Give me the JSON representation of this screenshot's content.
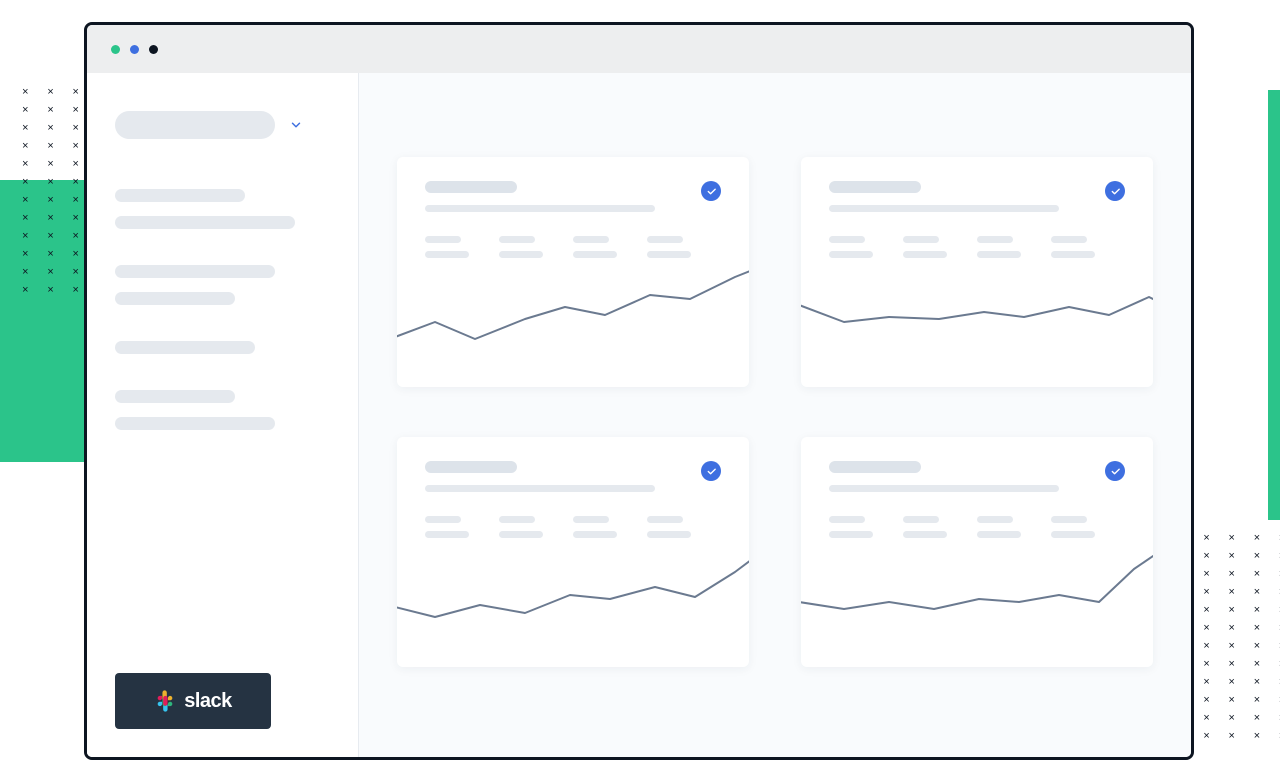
{
  "decorative": {
    "x_char": "×"
  },
  "window": {
    "dots": [
      "green",
      "blue",
      "dark"
    ]
  },
  "sidebar": {
    "selector": {
      "placeholder": ""
    },
    "groups": [
      {
        "lines": [
          130,
          180
        ]
      },
      {
        "lines": [
          160,
          120
        ]
      },
      {
        "lines": [
          140
        ]
      },
      {
        "lines": [
          120,
          160
        ]
      }
    ],
    "slack_label": "slack"
  },
  "cards": [
    {
      "checked": true,
      "chart": "up"
    },
    {
      "checked": true,
      "chart": "flat"
    },
    {
      "checked": true,
      "chart": "up2"
    },
    {
      "checked": true,
      "chart": "up3"
    }
  ],
  "colors": {
    "accent": "#3E6FE0",
    "green": "#2BC48A",
    "dark": "#253342",
    "skeleton": "#E5E9EE"
  }
}
